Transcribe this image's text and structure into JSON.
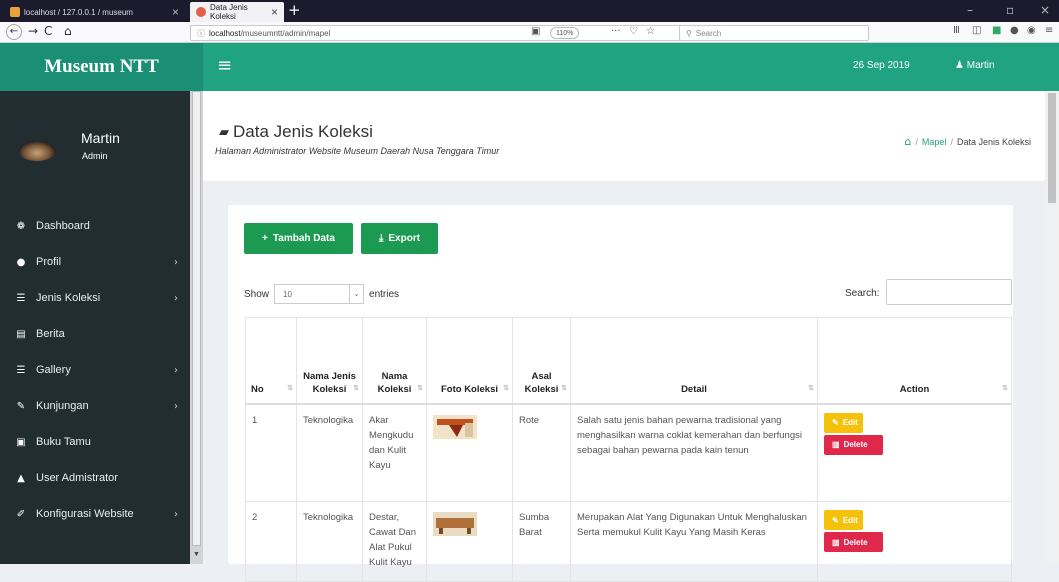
{
  "browser": {
    "tabs": [
      {
        "label": "localhost / 127.0.0.1 / museum",
        "close": "×"
      },
      {
        "label": "Data Jenis Koleksi",
        "close": "×"
      }
    ],
    "new_tab": "+",
    "window_controls": {
      "minimize": "–",
      "restore": "▫",
      "close": "×"
    },
    "nav": {
      "back": "←",
      "forward": "→",
      "reload": "C",
      "home": "⌂"
    },
    "url_host": "localhost",
    "url_path": "/museumntt/admin/mapel",
    "zoom": "110%",
    "menu_dots": "···",
    "search_placeholder": "Search"
  },
  "app": {
    "logo": "Museum NTT",
    "date": "26 Sep 2019",
    "user": "Martin",
    "accent": "#1fa380",
    "sidebar_bg": "#222d32"
  },
  "sidebar": {
    "user_name": "Martin",
    "user_role": "Admin",
    "items": [
      {
        "label": "Dashboard",
        "icon": "dashboard-icon",
        "has_sub": false
      },
      {
        "label": "Profil",
        "icon": "info-circle-icon",
        "has_sub": true
      },
      {
        "label": "Jenis Koleksi",
        "icon": "list-icon",
        "has_sub": true
      },
      {
        "label": "Berita",
        "icon": "newspaper-icon",
        "has_sub": false
      },
      {
        "label": "Gallery",
        "icon": "list-icon",
        "has_sub": true
      },
      {
        "label": "Kunjungan",
        "icon": "pin-icon",
        "has_sub": true
      },
      {
        "label": "Buku Tamu",
        "icon": "book-icon",
        "has_sub": false
      },
      {
        "label": "User Admistrator",
        "icon": "lock-icon",
        "has_sub": false
      },
      {
        "label": "Konfigurasi Website",
        "icon": "wrench-icon",
        "has_sub": true
      }
    ]
  },
  "page": {
    "title": "Data Jenis Koleksi",
    "subtitle": "Halaman Administrator Website Museum Daerah Nusa Tenggara Timur",
    "breadcrumb": {
      "link": "Mapel",
      "sep": "/",
      "current": "Data Jenis Koleksi"
    }
  },
  "toolbar": {
    "add_label": "Tambah Data",
    "export_label": "Export"
  },
  "datatable": {
    "show_label": "Show",
    "entries_value": "10",
    "entries_label": "entries",
    "search_label": "Search:",
    "columns": [
      "No",
      "Nama Jenis Koleksi",
      "Nama Koleksi",
      "Foto Koleksi",
      "Asal Koleksi",
      "Detail",
      "Action"
    ],
    "rows": [
      {
        "no": "1",
        "jenis": "Teknologika",
        "nama": "Akar Mengkudu dan Kulit Kayu",
        "asal": "Rote",
        "detail": "Salah satu jenis bahan pewarna tradisional yang menghasilkan warna coklat kemerahan dan berfungsi sebagai bahan pewarna pada kain tenun",
        "edit": "Edit",
        "delete": "Delete"
      },
      {
        "no": "2",
        "jenis": "Teknologika",
        "nama": "Destar, Cawat Dan Alat Pukul Kulit Kayu",
        "asal": "Sumba Barat",
        "detail": "Merupakan Alat Yang Digunakan Untuk Menghaluskan Serta memukul Kulit Kayu Yang Masih Keras",
        "edit": "Edit",
        "delete": "Delete"
      }
    ]
  }
}
